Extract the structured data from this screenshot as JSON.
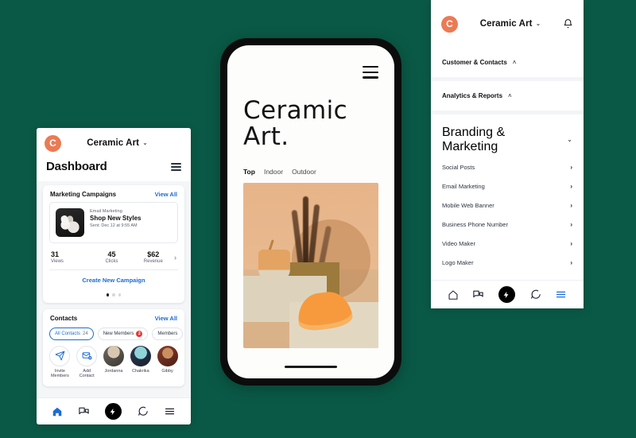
{
  "theme": {
    "background": "#0a5946",
    "brand_orange": "#ec7a54",
    "link_blue": "#1b6bd6",
    "badge_red": "#e53935",
    "card_white": "#ffffff",
    "panel_grey": "#f4f6f8"
  },
  "left_phone": {
    "appbar": {
      "logo_letter": "C",
      "brand": "Ceramic Art",
      "caret": "⌄"
    },
    "page_title": "Dashboard",
    "filter_icon": "filter-sliders-icon",
    "campaigns_card": {
      "title": "Marketing Campaigns",
      "view_all": "View All",
      "item": {
        "kicker": "Email Marketing",
        "name": "Shop New Styles",
        "sent": "Sent: Dec 12 at 9:55 AM"
      },
      "stats": [
        {
          "value": "31",
          "label": "Views"
        },
        {
          "value": "45",
          "label": "Clicks"
        },
        {
          "value": "$62",
          "label": "Revenue"
        }
      ],
      "chevron": "›",
      "create_link": "Create New Campaign",
      "dots": {
        "count": 3,
        "active": 0
      }
    },
    "contacts_card": {
      "title": "Contacts",
      "view_all": "View All",
      "chips": [
        {
          "label": "All Contacts",
          "count": "24",
          "active": true,
          "badge": null
        },
        {
          "label": "New Members",
          "count": null,
          "active": false,
          "badge": "2"
        },
        {
          "label": "Members",
          "count": null,
          "active": false,
          "badge": null
        }
      ],
      "people": [
        {
          "name": "Invite Members",
          "type": "action",
          "icon": "send-icon"
        },
        {
          "name": "Add Contact",
          "type": "action",
          "icon": "add-mail-icon"
        },
        {
          "name": "Jordanna",
          "type": "avatar",
          "icon": "avatar-1"
        },
        {
          "name": "Chakrika",
          "type": "avatar",
          "icon": "avatar-2"
        },
        {
          "name": "Gibby",
          "type": "avatar",
          "icon": "avatar-3"
        }
      ]
    },
    "tabbar": [
      {
        "name": "home-icon",
        "label": "Home",
        "active": true
      },
      {
        "name": "campaigns-icon",
        "label": "Campaigns",
        "active": false
      },
      {
        "name": "bolt-fab-icon",
        "label": "Create",
        "active": false
      },
      {
        "name": "chat-icon",
        "label": "Messages",
        "active": false
      },
      {
        "name": "menu-icon",
        "label": "More",
        "active": false
      }
    ]
  },
  "center_phone": {
    "menu_icon": "hamburger-icon",
    "headline": "Ceramic Art.",
    "tabs": [
      {
        "label": "Top",
        "selected": true
      },
      {
        "label": "Indoor",
        "selected": false
      },
      {
        "label": "Outdoor",
        "selected": false
      }
    ],
    "hero_image_alt": "ceramic-still-life-photo"
  },
  "right_panel": {
    "appbar": {
      "logo_letter": "C",
      "brand": "Ceramic Art",
      "caret": "⌄",
      "bell": "bell-icon"
    },
    "sections": [
      {
        "label": "Customer & Contacts",
        "chevron": "˄",
        "expanded": true
      },
      {
        "label": "Analytics & Reports",
        "chevron": "˄",
        "expanded": true
      }
    ],
    "group": {
      "label": "Branding & Marketing",
      "chevron": "⌄"
    },
    "items": [
      {
        "label": "Social Posts",
        "chevron": "›"
      },
      {
        "label": "Email Marketing",
        "chevron": "›"
      },
      {
        "label": "Mobile Web Banner",
        "chevron": "›"
      },
      {
        "label": "Business Phone Number",
        "chevron": "›"
      },
      {
        "label": "Video Maker",
        "chevron": "›"
      },
      {
        "label": "Logo Maker",
        "chevron": "›"
      }
    ],
    "tabbar": [
      {
        "name": "home-icon",
        "label": "Home",
        "active": false
      },
      {
        "name": "campaigns-icon",
        "label": "Campaigns",
        "active": false
      },
      {
        "name": "bolt-fab-icon",
        "label": "Create",
        "active": false
      },
      {
        "name": "chat-icon",
        "label": "Messages",
        "active": false
      },
      {
        "name": "menu-icon",
        "label": "More",
        "active": true
      }
    ]
  }
}
